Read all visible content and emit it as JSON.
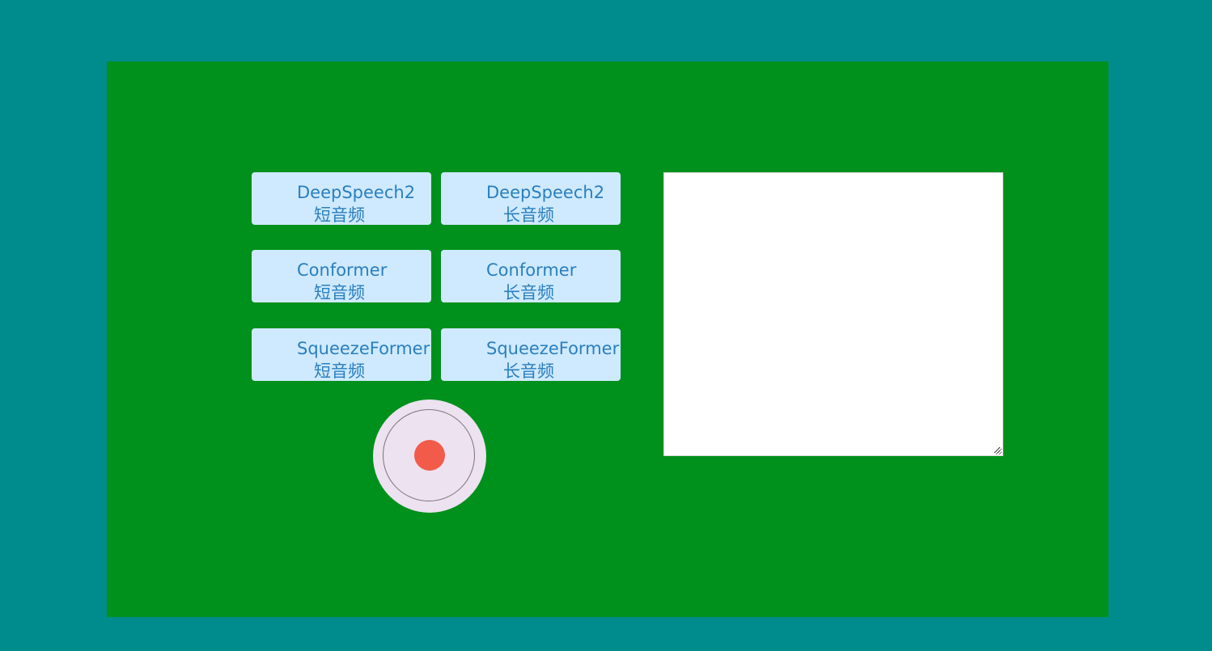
{
  "buttons": [
    {
      "model": "DeepSpeech2",
      "mode": "短音频"
    },
    {
      "model": "DeepSpeech2",
      "mode": "长音频"
    },
    {
      "model": "Conformer",
      "mode": "短音频"
    },
    {
      "model": "Conformer",
      "mode": "长音频"
    },
    {
      "model": "SqueezeFormer",
      "mode": "短音频"
    },
    {
      "model": "SqueezeFormer",
      "mode": "长音频"
    }
  ],
  "record_button": {
    "icon": "record-icon",
    "color": "#f25a4a"
  },
  "result_box": {
    "value": "",
    "placeholder": ""
  },
  "colors": {
    "page_background": "#008c8c",
    "panel_background": "#00901c",
    "button_background": "#cfeaff",
    "button_text": "#2a7fbf",
    "record_button_background": "#ece2f0"
  }
}
